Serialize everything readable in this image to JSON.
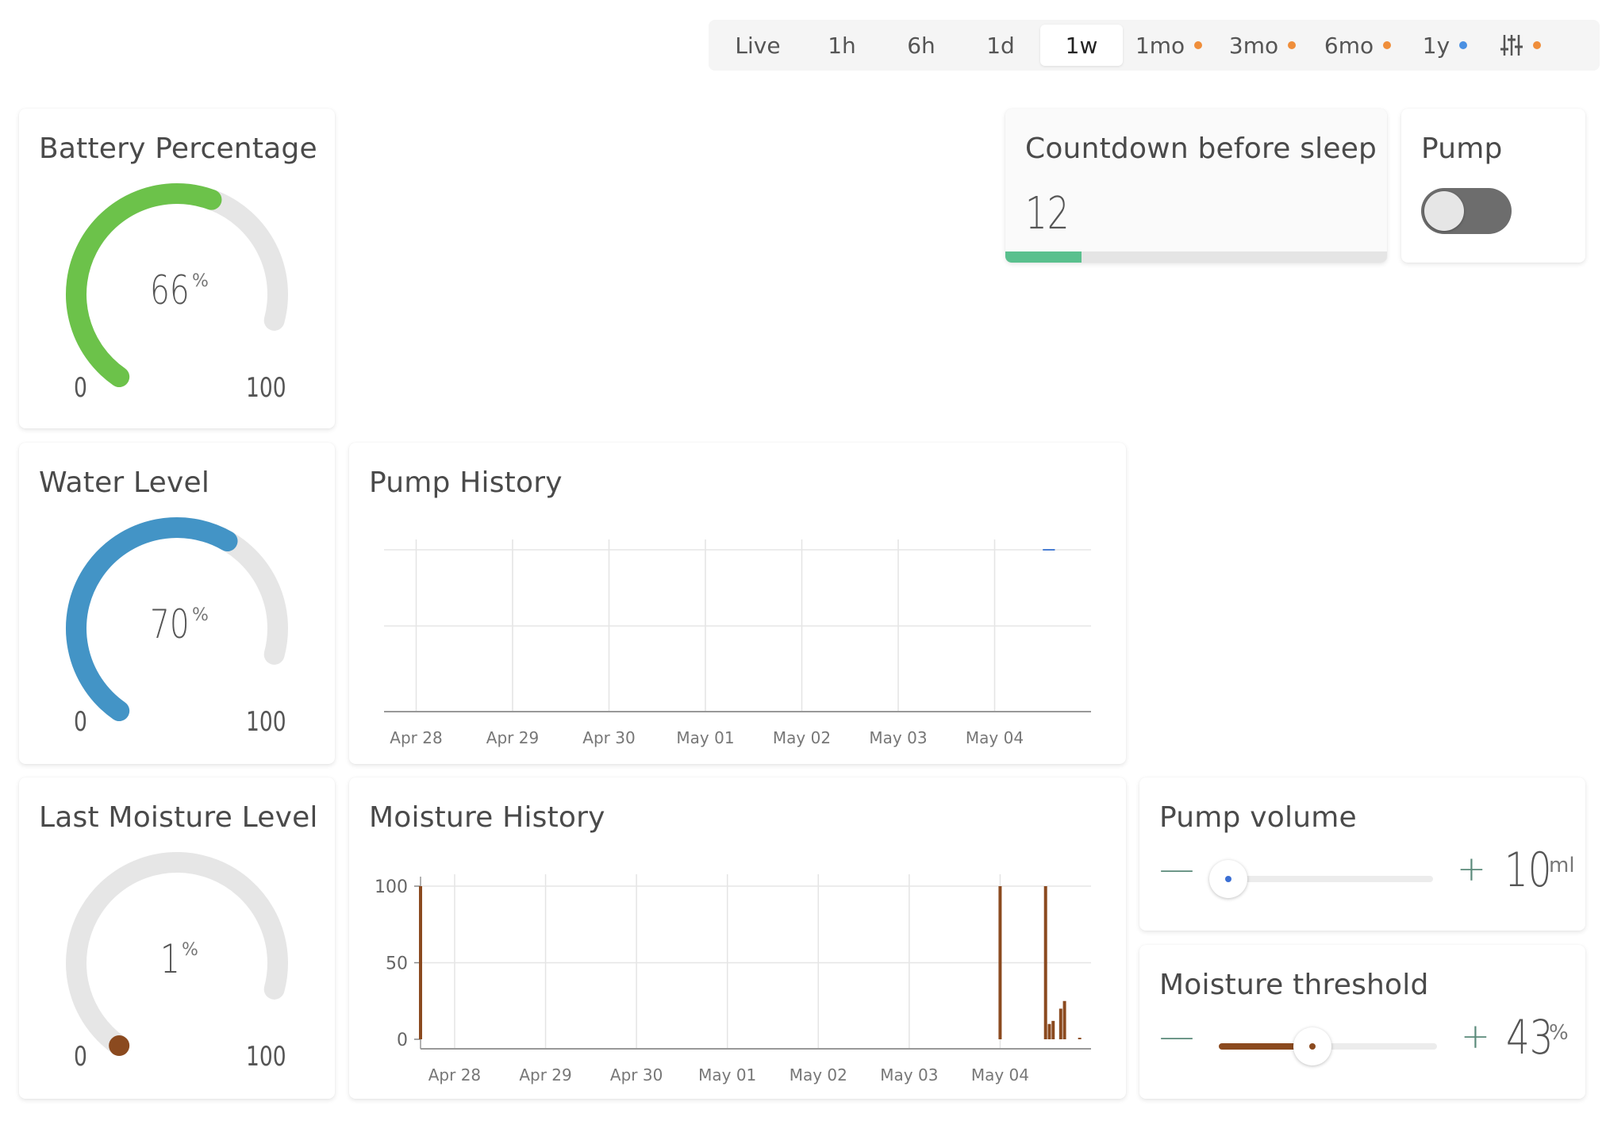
{
  "toolbar": {
    "items": [
      {
        "label": "Live",
        "dot": null,
        "active": false
      },
      {
        "label": "1h",
        "dot": null,
        "active": false
      },
      {
        "label": "6h",
        "dot": null,
        "active": false
      },
      {
        "label": "1d",
        "dot": null,
        "active": false
      },
      {
        "label": "1w",
        "dot": null,
        "active": true
      },
      {
        "label": "1mo",
        "dot": "#ef8e3b",
        "active": false
      },
      {
        "label": "3mo",
        "dot": "#ef8e3b",
        "active": false
      },
      {
        "label": "6mo",
        "dot": "#ef8e3b",
        "active": false
      },
      {
        "label": "1y",
        "dot": "#4a90e2",
        "active": false
      }
    ],
    "settings_icon": "sliders-icon",
    "settings_dot": "#ef8e3b"
  },
  "battery": {
    "title": "Battery Percentage",
    "value": "66",
    "unit": "%",
    "min": "0",
    "max": "100",
    "fraction": 0.66,
    "color": "#6cc24a"
  },
  "water": {
    "title": "Water Level",
    "value": "70",
    "unit": "%",
    "min": "0",
    "max": "100",
    "fraction": 0.7,
    "color": "#4394c6"
  },
  "moisture": {
    "title": "Last Moisture Level",
    "value": "1",
    "unit": "%",
    "min": "0",
    "max": "100",
    "fraction": 0.01,
    "color": "#8b4a1f"
  },
  "countdown": {
    "title": "Countdown before sleep",
    "value": "12",
    "fraction": 0.2,
    "color": "#5ac08e"
  },
  "pump": {
    "title": "Pump",
    "on": false
  },
  "pump_history": {
    "title": "Pump History"
  },
  "moisture_history": {
    "title": "Moisture History"
  },
  "pump_volume": {
    "title": "Pump volume",
    "minus": "—",
    "plus": "+",
    "value": "10",
    "unit": "ml",
    "fraction": 0.0,
    "color": "#3b6fd4"
  },
  "moisture_threshold": {
    "title": "Moisture threshold",
    "minus": "—",
    "plus": "+",
    "value": "43",
    "unit": "%",
    "fraction": 0.43,
    "color": "#8b4a1f"
  },
  "chart_data": [
    {
      "type": "line",
      "title": "Pump History",
      "x_ticks": [
        "Apr 28",
        "Apr 29",
        "Apr 30",
        "May 01",
        "May 02",
        "May 03",
        "May 04"
      ],
      "x_range": [
        "2024-04-27T16:00",
        "2024-05-05T00:00"
      ],
      "series": [
        {
          "color": "#4a7fd4",
          "points": [
            {
              "x": "2024-05-04T12:00",
              "y": 1
            },
            {
              "x": "2024-05-04T15:00",
              "y": 1
            }
          ]
        }
      ],
      "ylim": [
        0,
        1
      ],
      "grid": true
    },
    {
      "type": "bar",
      "title": "Moisture History",
      "x_ticks": [
        "Apr 28",
        "Apr 29",
        "Apr 30",
        "May 01",
        "May 02",
        "May 03",
        "May 04"
      ],
      "y_ticks": [
        "100",
        "50",
        "0"
      ],
      "x_range": [
        "2024-04-27T15:00",
        "2024-05-05T00:00"
      ],
      "ylim": [
        0,
        100
      ],
      "series": [
        {
          "color": "#8b4a1f",
          "points": [
            {
              "x": "2024-04-27T15:00",
              "y": 100
            },
            {
              "x": "2024-05-04T00:00",
              "y": 100
            },
            {
              "x": "2024-05-04T12:00",
              "y": 100
            },
            {
              "x": "2024-05-04T13:00",
              "y": 10
            },
            {
              "x": "2024-05-04T14:00",
              "y": 12
            },
            {
              "x": "2024-05-04T16:00",
              "y": 20
            },
            {
              "x": "2024-05-04T17:00",
              "y": 25
            },
            {
              "x": "2024-05-04T21:00",
              "y": 1
            }
          ]
        }
      ],
      "grid": true
    }
  ]
}
